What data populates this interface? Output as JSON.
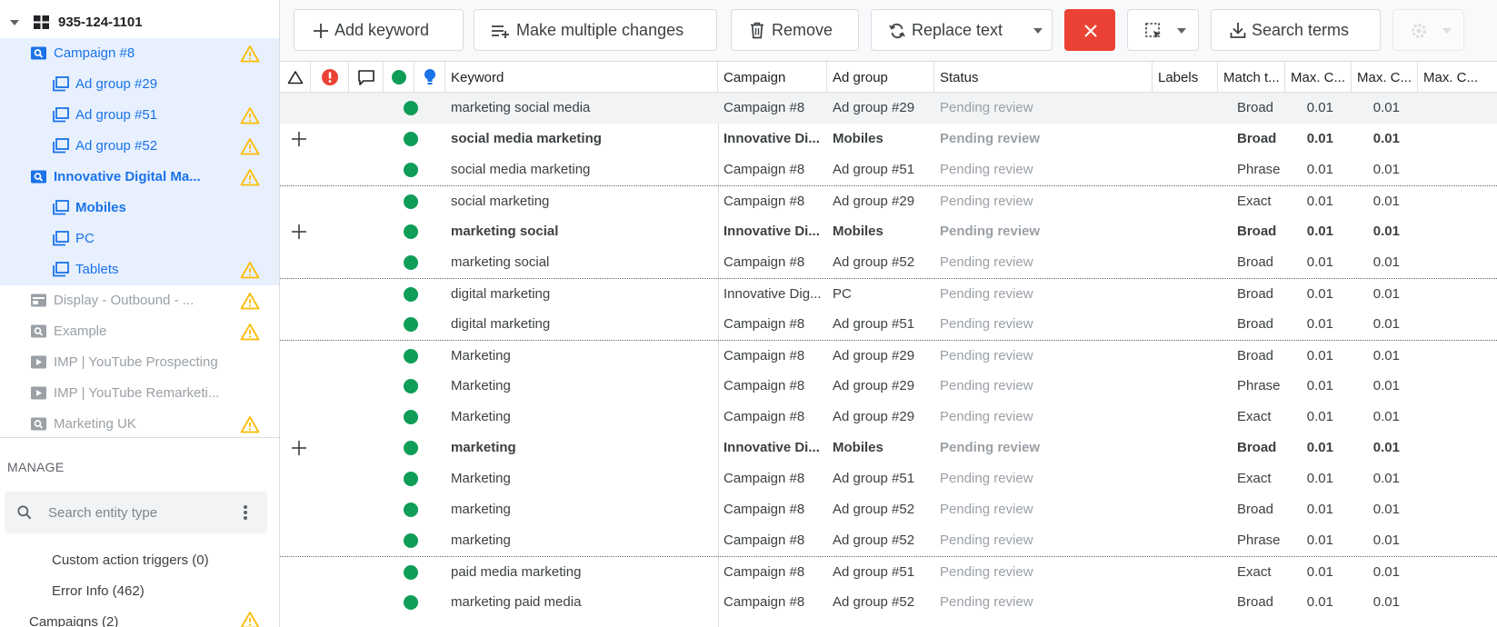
{
  "colors": {
    "accent": "#1a73e8",
    "selected_bg": "#e8f0fe",
    "warning": "#fbbc04",
    "success": "#0f9d58",
    "danger": "#ea4335"
  },
  "sidebar": {
    "account": {
      "label": "935-124-1101",
      "icon": "grid-icon"
    },
    "tree": [
      {
        "label": "Campaign #8",
        "icon": "search-campaign-icon",
        "warning": true
      },
      {
        "label": "Ad group #29",
        "icon": "ad-group-icon",
        "warning": false
      },
      {
        "label": "Ad group #51",
        "icon": "ad-group-icon",
        "warning": true
      },
      {
        "label": "Ad group #52",
        "icon": "ad-group-icon",
        "warning": true
      },
      {
        "label": "Innovative Digital Ma...",
        "icon": "search-campaign-icon",
        "warning": true
      },
      {
        "label": "Mobiles",
        "icon": "ad-group-icon",
        "warning": false
      },
      {
        "label": "PC",
        "icon": "ad-group-icon",
        "warning": false
      },
      {
        "label": "Tablets",
        "icon": "ad-group-icon",
        "warning": true
      },
      {
        "label": "Display - Outbound - ...",
        "icon": "display-campaign-icon",
        "warning": true
      },
      {
        "label": "Example",
        "icon": "search-campaign-icon",
        "warning": true
      },
      {
        "label": "IMP | YouTube Prospecting",
        "icon": "video-campaign-icon",
        "warning": false
      },
      {
        "label": "IMP | YouTube Remarketi...",
        "icon": "video-campaign-icon",
        "warning": false
      },
      {
        "label": "Marketing UK",
        "icon": "search-campaign-icon",
        "warning": true
      }
    ],
    "manage": {
      "title": "MANAGE",
      "search_placeholder": "Search entity type",
      "links": [
        "Custom action triggers (0)",
        "Error Info (462)"
      ],
      "campaigns_label": "Campaigns (2)"
    }
  },
  "toolbar": {
    "add_keyword": "Add keyword",
    "make_changes": "Make multiple changes",
    "remove": "Remove",
    "replace_text": "Replace text",
    "search_terms": "Search terms"
  },
  "grid": {
    "columns": [
      "Keyword",
      "Campaign",
      "Ad group",
      "Status",
      "Labels",
      "Match t...",
      "Max. C...",
      "Max. C...",
      "Max. C..."
    ],
    "rows": [
      {
        "plus": false,
        "bold": false,
        "sep": false,
        "keyword": "marketing social media",
        "campaign": "Campaign #8",
        "adgroup": "Ad group #29",
        "status": "Pending review",
        "match": "Broad",
        "max1": "0.01",
        "max2": "0.01"
      },
      {
        "plus": true,
        "bold": true,
        "sep": false,
        "keyword": "social media marketing",
        "campaign": "Innovative Di...",
        "adgroup": "Mobiles",
        "status": "Pending review",
        "match": "Broad",
        "max1": "0.01",
        "max2": "0.01"
      },
      {
        "plus": false,
        "bold": false,
        "sep": false,
        "keyword": "social media marketing",
        "campaign": "Campaign #8",
        "adgroup": "Ad group #51",
        "status": "Pending review",
        "match": "Phrase",
        "max1": "0.01",
        "max2": "0.01"
      },
      {
        "plus": false,
        "bold": false,
        "sep": true,
        "keyword": "social marketing",
        "campaign": "Campaign #8",
        "adgroup": "Ad group #29",
        "status": "Pending review",
        "match": "Exact",
        "max1": "0.01",
        "max2": "0.01"
      },
      {
        "plus": true,
        "bold": true,
        "sep": false,
        "keyword": "marketing social",
        "campaign": "Innovative Di...",
        "adgroup": "Mobiles",
        "status": "Pending review",
        "match": "Broad",
        "max1": "0.01",
        "max2": "0.01"
      },
      {
        "plus": false,
        "bold": false,
        "sep": false,
        "keyword": "marketing social",
        "campaign": "Campaign #8",
        "adgroup": "Ad group #52",
        "status": "Pending review",
        "match": "Broad",
        "max1": "0.01",
        "max2": "0.01"
      },
      {
        "plus": false,
        "bold": false,
        "sep": true,
        "keyword": "digital marketing",
        "campaign": "Innovative Dig...",
        "adgroup": "PC",
        "status": "Pending review",
        "match": "Broad",
        "max1": "0.01",
        "max2": "0.01"
      },
      {
        "plus": false,
        "bold": false,
        "sep": false,
        "keyword": "digital marketing",
        "campaign": "Campaign #8",
        "adgroup": "Ad group #51",
        "status": "Pending review",
        "match": "Broad",
        "max1": "0.01",
        "max2": "0.01"
      },
      {
        "plus": false,
        "bold": false,
        "sep": true,
        "keyword": "Marketing",
        "campaign": "Campaign #8",
        "adgroup": "Ad group #29",
        "status": "Pending review",
        "match": "Broad",
        "max1": "0.01",
        "max2": "0.01"
      },
      {
        "plus": false,
        "bold": false,
        "sep": false,
        "keyword": "Marketing",
        "campaign": "Campaign #8",
        "adgroup": "Ad group #29",
        "status": "Pending review",
        "match": "Phrase",
        "max1": "0.01",
        "max2": "0.01"
      },
      {
        "plus": false,
        "bold": false,
        "sep": false,
        "keyword": "Marketing",
        "campaign": "Campaign #8",
        "adgroup": "Ad group #29",
        "status": "Pending review",
        "match": "Exact",
        "max1": "0.01",
        "max2": "0.01"
      },
      {
        "plus": true,
        "bold": true,
        "sep": false,
        "keyword": "marketing",
        "campaign": "Innovative Di...",
        "adgroup": "Mobiles",
        "status": "Pending review",
        "match": "Broad",
        "max1": "0.01",
        "max2": "0.01"
      },
      {
        "plus": false,
        "bold": false,
        "sep": false,
        "keyword": "Marketing",
        "campaign": "Campaign #8",
        "adgroup": "Ad group #51",
        "status": "Pending review",
        "match": "Exact",
        "max1": "0.01",
        "max2": "0.01"
      },
      {
        "plus": false,
        "bold": false,
        "sep": false,
        "keyword": "marketing",
        "campaign": "Campaign #8",
        "adgroup": "Ad group #52",
        "status": "Pending review",
        "match": "Broad",
        "max1": "0.01",
        "max2": "0.01"
      },
      {
        "plus": false,
        "bold": false,
        "sep": false,
        "keyword": "marketing",
        "campaign": "Campaign #8",
        "adgroup": "Ad group #52",
        "status": "Pending review",
        "match": "Phrase",
        "max1": "0.01",
        "max2": "0.01"
      },
      {
        "plus": false,
        "bold": false,
        "sep": true,
        "keyword": "paid media marketing",
        "campaign": "Campaign #8",
        "adgroup": "Ad group #51",
        "status": "Pending review",
        "match": "Exact",
        "max1": "0.01",
        "max2": "0.01"
      },
      {
        "plus": false,
        "bold": false,
        "sep": false,
        "keyword": "marketing paid media",
        "campaign": "Campaign #8",
        "adgroup": "Ad group #52",
        "status": "Pending review",
        "match": "Broad",
        "max1": "0.01",
        "max2": "0.01"
      }
    ]
  }
}
